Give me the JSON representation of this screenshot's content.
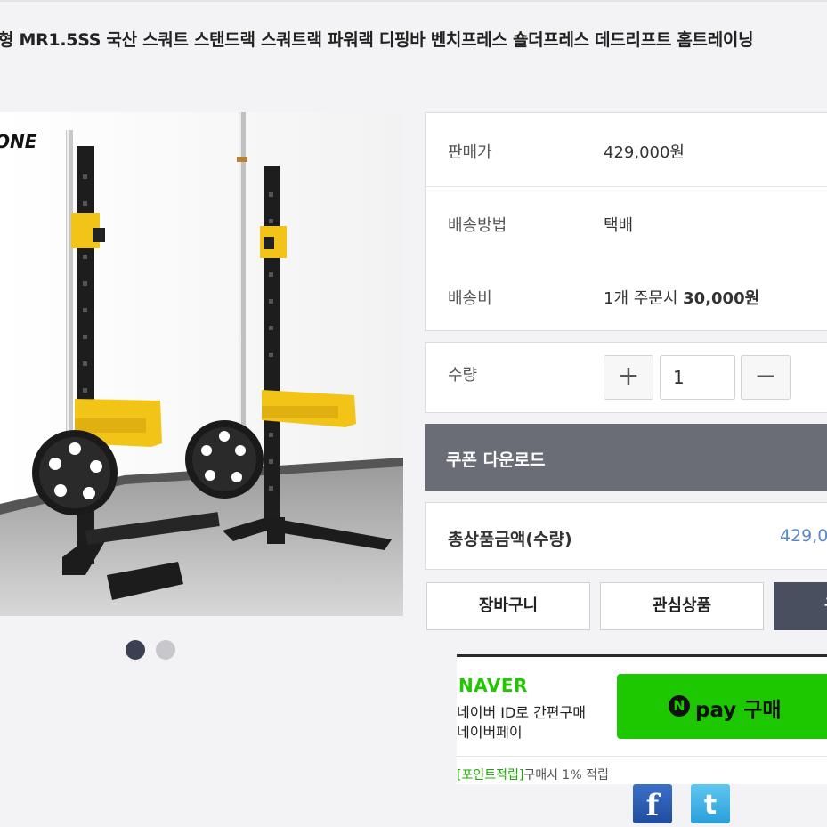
{
  "title": "형 MR1.5SS 국산 스쿼트 스탠드랙 스쿼트랙 파워랙 디핑바 벤치프레스 숄더프레스 데드리프트 홈트레이닝",
  "product_image": {
    "brand_text": "ONE"
  },
  "info": {
    "price_label": "판매가",
    "price_value": "429,000원",
    "shipping_method_label": "배송방법",
    "shipping_method_value": "택배",
    "shipping_fee_label": "배송비",
    "shipping_fee_prefix": "1개 주문시 ",
    "shipping_fee_amount": "30,000원"
  },
  "quantity": {
    "label": "수량",
    "value": "1",
    "minus": "+",
    "plus": "−"
  },
  "coupon_label": "쿠폰 다운로드",
  "total": {
    "label": "총상품금액(수량)",
    "value": "429,0"
  },
  "buttons": {
    "cart": "장바구니",
    "wishlist": "관심상품",
    "buy": "구"
  },
  "naver": {
    "logo": "NAVER",
    "line1": "네이버 ID로 간편구매",
    "line2": "네이버페이",
    "pay_n": "N",
    "pay_text": "pay 구매",
    "points_tag": "[포인트적립]",
    "points_text": "구매시 1% 적립"
  },
  "social": {
    "facebook": "f",
    "twitter": "t"
  },
  "colors": {
    "accent_dark": "#4a4f60",
    "coupon_bg": "#6a6d75",
    "naver_green": "#1ec800",
    "price_blue": "#5b8ac6"
  }
}
